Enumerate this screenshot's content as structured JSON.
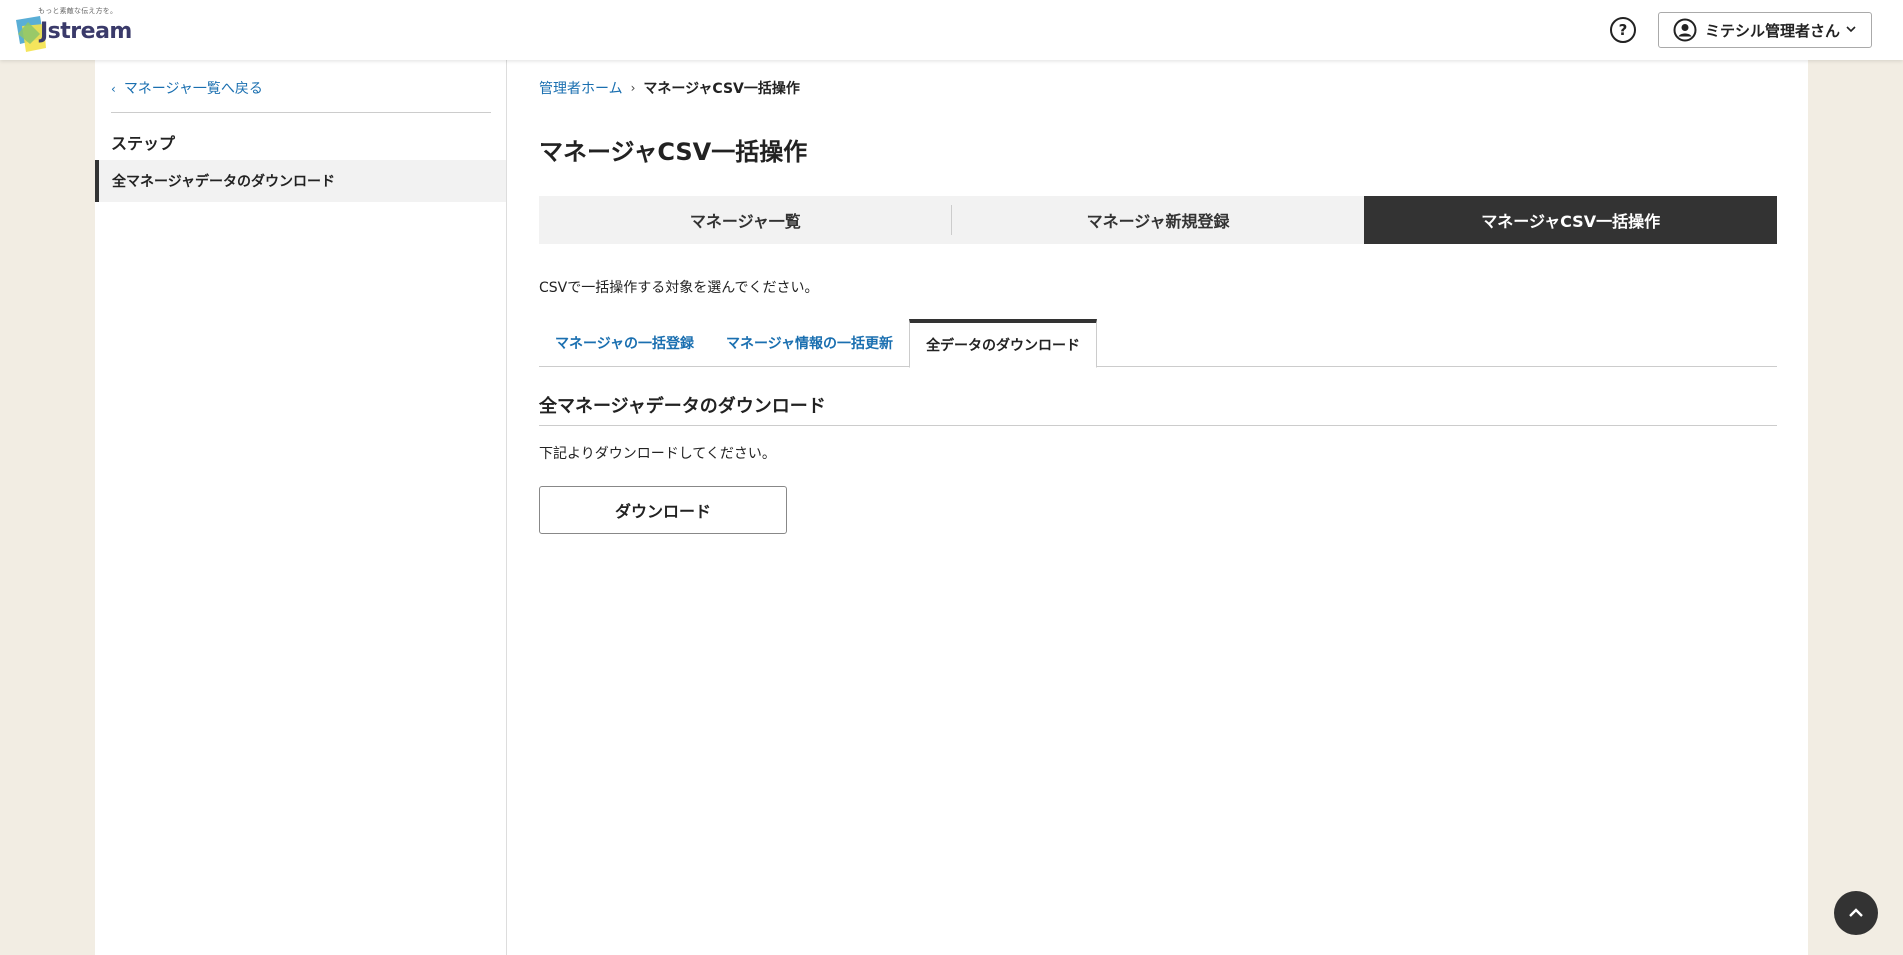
{
  "header": {
    "logo_tagline": "もっと素敵な伝え方を。",
    "logo_text": "Jstream",
    "help_symbol": "?",
    "user_name": "ミテシル管理者さん",
    "help_icon": "question-circle-icon",
    "user_icon": "user-circle-icon",
    "chevron_icon": "chevron-down-icon"
  },
  "sidebar": {
    "back_link": "マネージャ一覧へ戻る",
    "step_heading": "ステップ",
    "steps": [
      {
        "label": "全マネージャデータのダウンロード",
        "active": true
      }
    ]
  },
  "main": {
    "breadcrumb": {
      "home": "管理者ホーム",
      "current": "マネージャCSV一括操作"
    },
    "page_title": "マネージャCSV一括操作",
    "segment_tabs": [
      {
        "label": "マネージャ一覧",
        "active": false
      },
      {
        "label": "マネージャ新規登録",
        "active": false
      },
      {
        "label": "マネージャCSV一括操作",
        "active": true
      }
    ],
    "instruction": "CSVで一括操作する対象を選んでください。",
    "sub_tabs": [
      {
        "label": "マネージャの一括登録",
        "active": false
      },
      {
        "label": "マネージャ情報の一括更新",
        "active": false
      },
      {
        "label": "全データのダウンロード",
        "active": true
      }
    ],
    "section_title": "全マネージャデータのダウンロード",
    "section_desc": "下記よりダウンロードしてください。",
    "download_button": "ダウンロード"
  },
  "colors": {
    "page_bg": "#f2ede3",
    "link": "#1a6fb0",
    "active_tab_bg": "#333333"
  }
}
